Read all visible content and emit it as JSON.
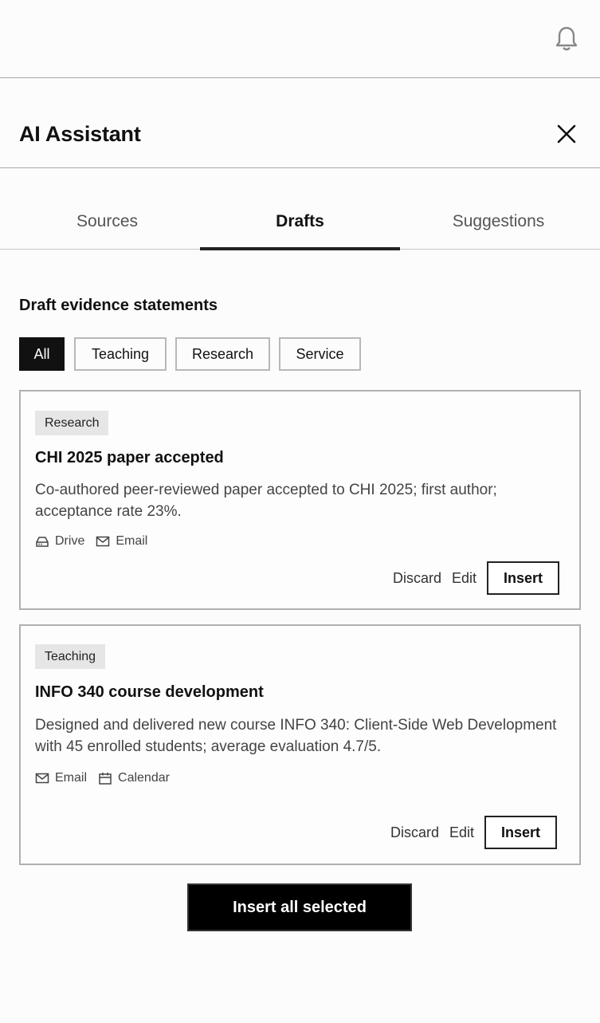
{
  "panel": {
    "title": "AI Assistant"
  },
  "tabs": [
    {
      "label": "Sources",
      "active": false
    },
    {
      "label": "Drafts",
      "active": true
    },
    {
      "label": "Suggestions",
      "active": false
    }
  ],
  "section": {
    "title": "Draft evidence statements"
  },
  "filters": [
    {
      "label": "All",
      "active": true
    },
    {
      "label": "Teaching",
      "active": false
    },
    {
      "label": "Research",
      "active": false
    },
    {
      "label": "Service",
      "active": false
    }
  ],
  "drafts": [
    {
      "tag": "Research",
      "title": "CHI 2025 paper accepted",
      "description": "Co-authored peer-reviewed paper accepted to CHI 2025; first author; acceptance rate 23%.",
      "sources": [
        {
          "icon": "drive-icon",
          "label": "Drive"
        },
        {
          "icon": "email-icon",
          "label": "Email"
        }
      ],
      "actions": {
        "discard": "Discard",
        "edit": "Edit",
        "insert": "Insert"
      }
    },
    {
      "tag": "Teaching",
      "title": "INFO 340 course development",
      "description": "Designed and delivered new course INFO 340: Client-Side Web Development with 45 enrolled students; average evaluation 4.7/5.",
      "sources": [
        {
          "icon": "email-icon",
          "label": "Email"
        },
        {
          "icon": "calendar-icon",
          "label": "Calendar"
        }
      ],
      "actions": {
        "discard": "Discard",
        "edit": "Edit",
        "insert": "Insert"
      }
    }
  ],
  "footer": {
    "insert_all_label": "Insert all selected"
  },
  "icons": {
    "notifications": "bell-icon",
    "close": "close-icon"
  }
}
